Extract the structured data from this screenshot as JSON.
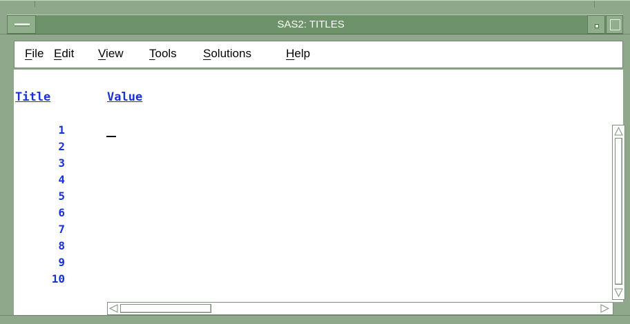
{
  "window": {
    "title": "SAS2: TITLES",
    "frame_color": "#8fa88c",
    "titlebar_color": "#6e9269"
  },
  "menubar": {
    "items": [
      {
        "label": "File",
        "mnemonic": "F"
      },
      {
        "label": "Edit",
        "mnemonic": "E"
      },
      {
        "label": "View",
        "mnemonic": "V"
      },
      {
        "label": "Tools",
        "mnemonic": "T"
      },
      {
        "label": "Solutions",
        "mnemonic": "S"
      },
      {
        "label": "Help",
        "mnemonic": "H"
      }
    ]
  },
  "table": {
    "headers": {
      "title": "Title",
      "value": "Value"
    },
    "rows": [
      {
        "title": "1",
        "value": ""
      },
      {
        "title": "2",
        "value": ""
      },
      {
        "title": "3",
        "value": ""
      },
      {
        "title": "4",
        "value": ""
      },
      {
        "title": "5",
        "value": ""
      },
      {
        "title": "6",
        "value": ""
      },
      {
        "title": "7",
        "value": ""
      },
      {
        "title": "8",
        "value": ""
      },
      {
        "title": "9",
        "value": ""
      },
      {
        "title": "10",
        "value": ""
      }
    ],
    "header_color": "#1a30d8"
  },
  "icons": {
    "system_menu": "system-menu-icon",
    "minimize": "minimize-icon",
    "maximize": "maximize-icon",
    "scroll_up": "arrow-up-icon",
    "scroll_down": "arrow-down-icon",
    "scroll_left": "arrow-left-icon",
    "scroll_right": "arrow-right-icon"
  }
}
